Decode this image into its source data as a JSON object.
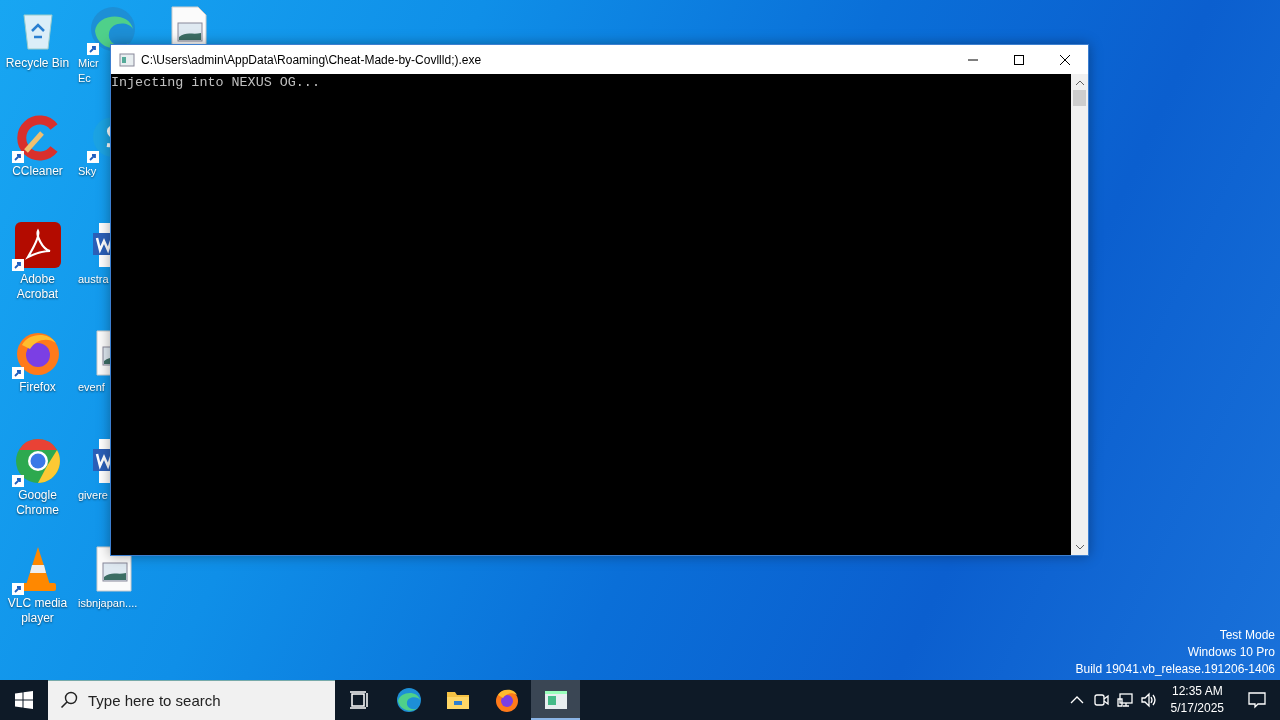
{
  "desktop": {
    "icons": [
      {
        "kind": "recycle-bin",
        "shortcut": false,
        "label": [
          "Recycle Bin"
        ]
      },
      {
        "kind": "ccleaner",
        "shortcut": true,
        "label": [
          "CCleaner"
        ]
      },
      {
        "kind": "acrobat",
        "shortcut": true,
        "label": [
          "Adobe",
          "Acrobat"
        ]
      },
      {
        "kind": "firefox",
        "shortcut": true,
        "label": [
          "Firefox"
        ]
      },
      {
        "kind": "chrome",
        "shortcut": true,
        "label": [
          "Google",
          "Chrome"
        ]
      },
      {
        "kind": "vlc",
        "shortcut": true,
        "label": [
          "VLC media",
          "player"
        ]
      },
      {
        "kind": "edge",
        "shortcut": true,
        "label": [
          "Micr",
          "Ec"
        ]
      },
      {
        "kind": "skype",
        "shortcut": true,
        "label": [
          "Sky"
        ]
      },
      {
        "kind": "word",
        "shortcut": false,
        "label": [
          "austra"
        ]
      },
      {
        "kind": "image",
        "shortcut": false,
        "label": [
          "evenf"
        ]
      },
      {
        "kind": "word",
        "shortcut": false,
        "label": [
          "givere"
        ]
      },
      {
        "kind": "image",
        "shortcut": false,
        "label": [
          "isbnjapan...."
        ]
      },
      {
        "kind": "image",
        "shortcut": false
      }
    ]
  },
  "window": {
    "title": "C:\\Users\\admin\\AppData\\Roaming\\Cheat-Made-by-Covllld;).exe",
    "lines": [
      "Injecting into NEXUS OG..."
    ]
  },
  "watermark": [
    "Test Mode",
    "Windows 10 Pro",
    "Build 19041.vb_release.191206-1406"
  ],
  "taskbar": {
    "search": {
      "placeholder": "Type here to search"
    },
    "apps": [
      {
        "kind": "task-view",
        "active": false
      },
      {
        "kind": "edge",
        "active": false
      },
      {
        "kind": "explorer",
        "active": false
      },
      {
        "kind": "firefox",
        "active": false
      },
      {
        "kind": "console",
        "active": true
      }
    ],
    "clock": {
      "time": "12:35 AM",
      "date": "5/17/2025"
    }
  }
}
